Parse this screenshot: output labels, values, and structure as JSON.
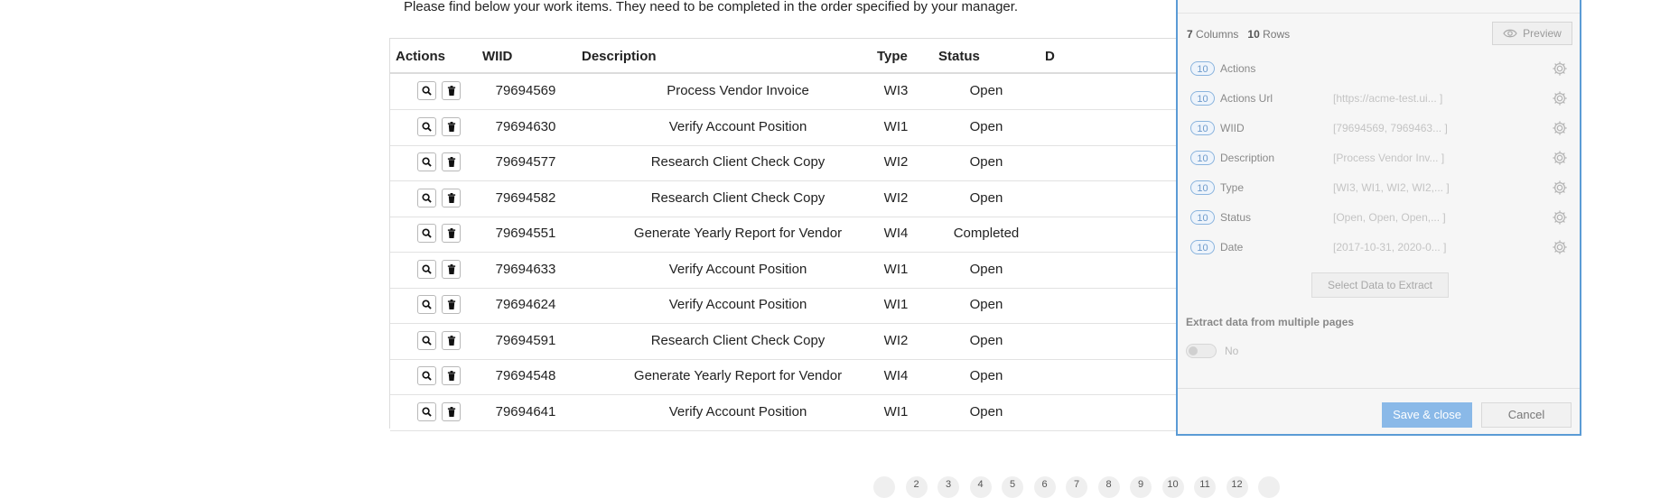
{
  "intro_text": "Please find below your work items. They need to be completed in the order specified by your manager.",
  "table": {
    "headers": [
      "Actions",
      "WIID",
      "Description",
      "Type",
      "Status",
      "D"
    ],
    "rows": [
      {
        "wiid": "79694569",
        "description": "Process Vendor Invoice",
        "type": "WI3",
        "status": "Open"
      },
      {
        "wiid": "79694630",
        "description": "Verify Account Position",
        "type": "WI1",
        "status": "Open"
      },
      {
        "wiid": "79694577",
        "description": "Research Client Check Copy",
        "type": "WI2",
        "status": "Open"
      },
      {
        "wiid": "79694582",
        "description": "Research Client Check Copy",
        "type": "WI2",
        "status": "Open"
      },
      {
        "wiid": "79694551",
        "description": "Generate Yearly Report for Vendor",
        "type": "WI4",
        "status": "Completed"
      },
      {
        "wiid": "79694633",
        "description": "Verify Account Position",
        "type": "WI1",
        "status": "Open"
      },
      {
        "wiid": "79694624",
        "description": "Verify Account Position",
        "type": "WI1",
        "status": "Open"
      },
      {
        "wiid": "79694591",
        "description": "Research Client Check Copy",
        "type": "WI2",
        "status": "Open"
      },
      {
        "wiid": "79694548",
        "description": "Generate Yearly Report for Vendor",
        "type": "WI4",
        "status": "Open"
      },
      {
        "wiid": "79694641",
        "description": "Verify Account Position",
        "type": "WI1",
        "status": "Open"
      }
    ],
    "row_icons": [
      "search-icon",
      "trash-icon"
    ]
  },
  "pagination": [
    "",
    "2",
    "3",
    "4",
    "5",
    "6",
    "7",
    "8",
    "9",
    "10",
    "11",
    "12",
    ""
  ],
  "panel": {
    "columns_count": "7",
    "columns_label": "Columns",
    "rows_count": "10",
    "rows_label": "Rows",
    "preview_label": "Preview",
    "fields": [
      {
        "count": "10",
        "name": "Actions",
        "sample": ""
      },
      {
        "count": "10",
        "name": "Actions Url",
        "sample": "[https://acme-test.ui... ]"
      },
      {
        "count": "10",
        "name": "WIID",
        "sample": "[79694569, 7969463... ]"
      },
      {
        "count": "10",
        "name": "Description",
        "sample": "[Process Vendor Inv... ]"
      },
      {
        "count": "10",
        "name": "Type",
        "sample": "[WI3, WI1, WI2, WI2,... ]"
      },
      {
        "count": "10",
        "name": "Status",
        "sample": "[Open, Open, Open,... ]"
      },
      {
        "count": "10",
        "name": "Date",
        "sample": "[2017-10-31, 2020-0... ]"
      }
    ],
    "select_data_label": "Select Data to Extract",
    "multi_pages_label": "Extract data from multiple pages",
    "toggle_value": "No",
    "save_label": "Save & close",
    "cancel_label": "Cancel"
  },
  "colors": {
    "accent": "#5b9bd5",
    "save_button": "#8ab9e8",
    "badge_border": "#8ab4de"
  }
}
